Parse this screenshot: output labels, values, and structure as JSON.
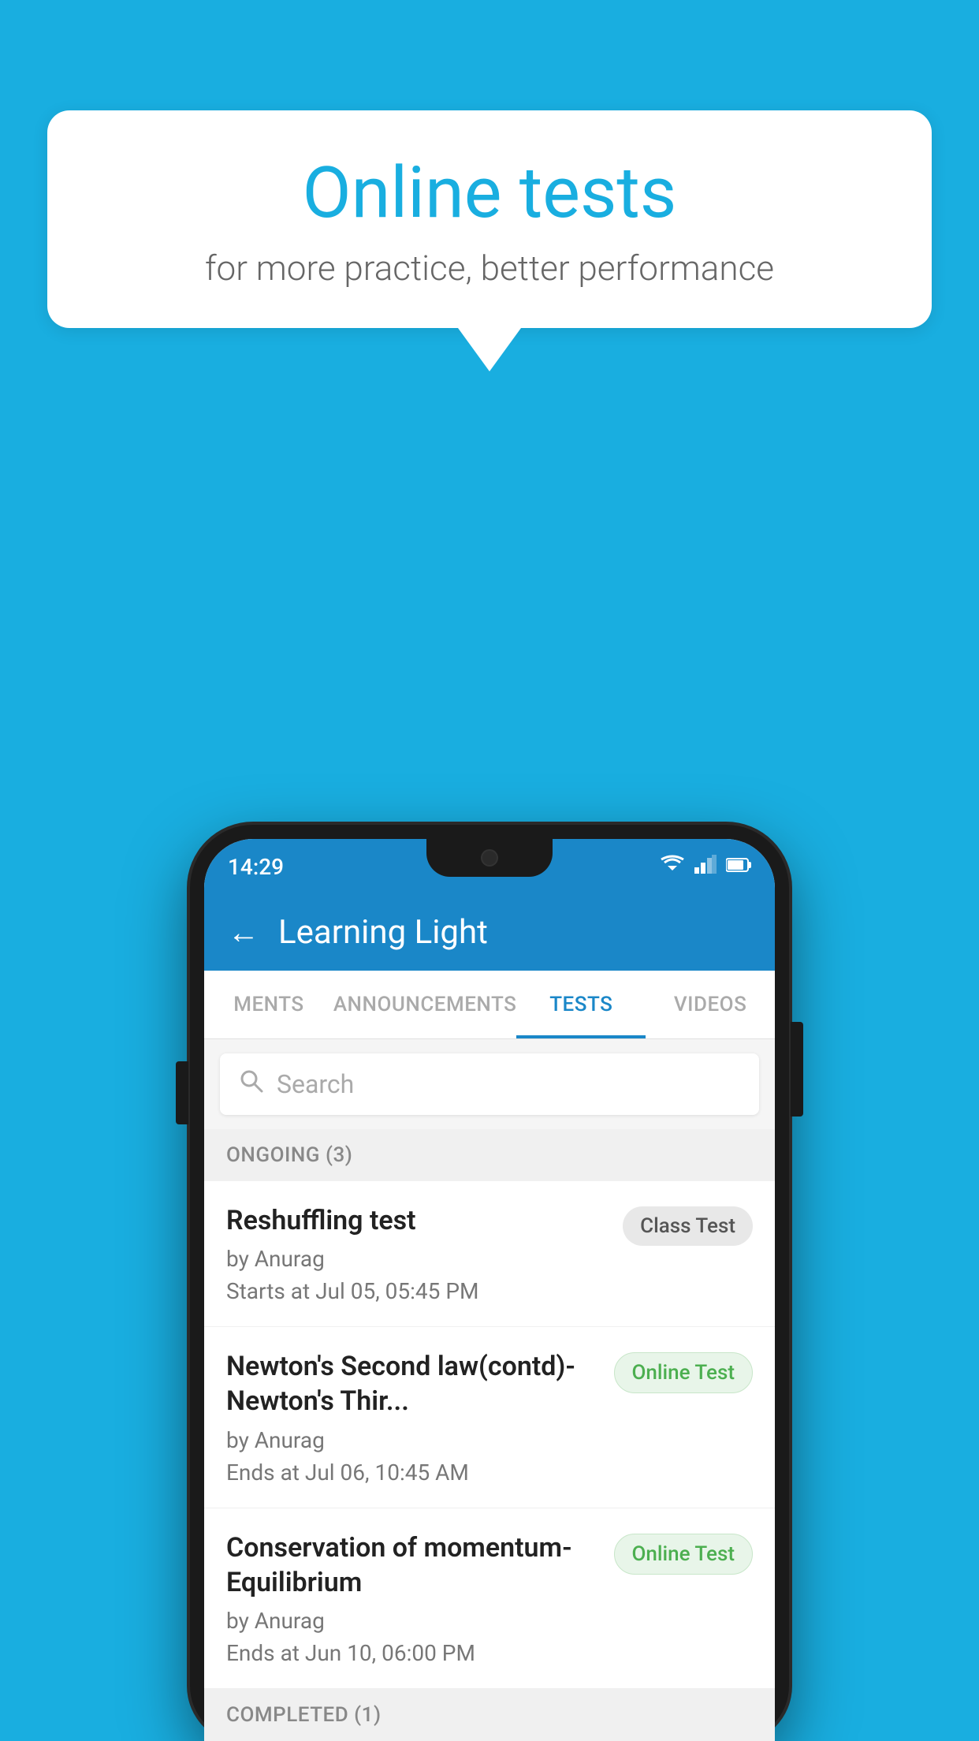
{
  "background": {
    "color": "#19aee0"
  },
  "speech_bubble": {
    "title": "Online tests",
    "subtitle": "for more practice, better performance"
  },
  "phone": {
    "status_bar": {
      "time": "14:29",
      "icons": [
        "wifi",
        "signal",
        "battery"
      ]
    },
    "header": {
      "title": "Learning Light",
      "back_label": "←"
    },
    "tabs": [
      {
        "label": "MENTS",
        "active": false
      },
      {
        "label": "ANNOUNCEMENTS",
        "active": false
      },
      {
        "label": "TESTS",
        "active": true
      },
      {
        "label": "VIDEOS",
        "active": false
      }
    ],
    "search": {
      "placeholder": "Search"
    },
    "ongoing_section": {
      "header": "ONGOING (3)",
      "items": [
        {
          "title": "Reshuffling test",
          "author": "by Anurag",
          "date": "Starts at  Jul 05, 05:45 PM",
          "badge": "Class Test",
          "badge_type": "class"
        },
        {
          "title": "Newton's Second law(contd)-Newton's Thir...",
          "author": "by Anurag",
          "date": "Ends at  Jul 06, 10:45 AM",
          "badge": "Online Test",
          "badge_type": "online"
        },
        {
          "title": "Conservation of momentum-Equilibrium",
          "author": "by Anurag",
          "date": "Ends at  Jun 10, 06:00 PM",
          "badge": "Online Test",
          "badge_type": "online"
        }
      ]
    },
    "completed_section": {
      "header": "COMPLETED (1)"
    }
  }
}
